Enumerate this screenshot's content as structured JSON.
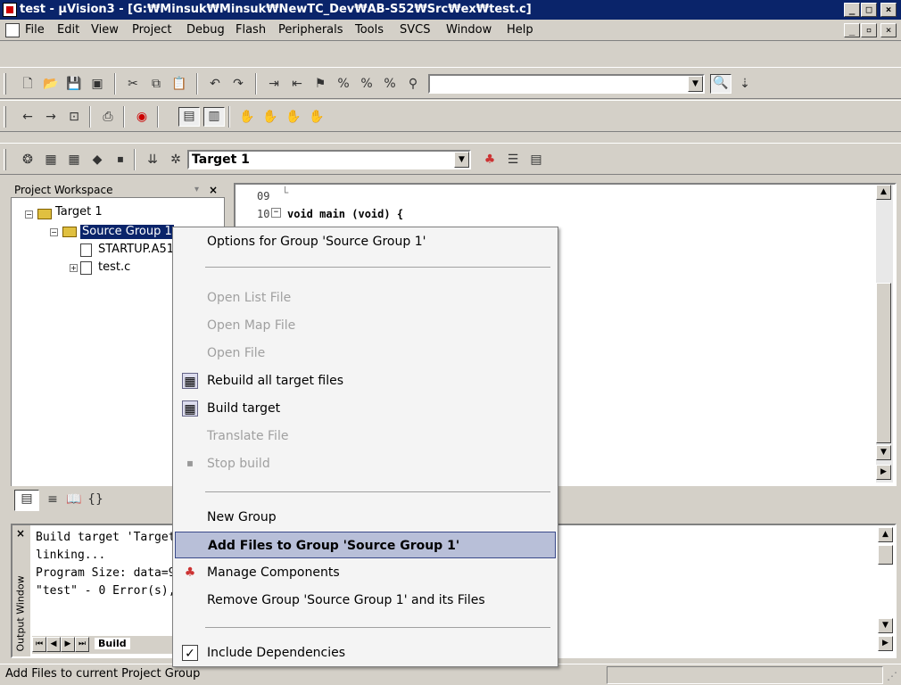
{
  "title_bar": {
    "title": "test  - µVision3 - [G:₩Minsuk₩Minsuk₩NewTC_Dev₩AB-S52₩Src₩ex₩test.c]",
    "min": "_",
    "max": "□",
    "close": "×"
  },
  "menu": {
    "items": [
      "File",
      "Edit",
      "View",
      "Project",
      "Debug",
      "Flash",
      "Peripherals",
      "Tools",
      "SVCS",
      "Window",
      "Help"
    ],
    "mdi_min": "_",
    "mdi_restore": "▫",
    "mdi_close": "×"
  },
  "toolbar": {
    "target_combo": "Target 1",
    "search_combo": ""
  },
  "workspace": {
    "header": "Project Workspace",
    "close": "×",
    "pin": "▾",
    "tree": {
      "target": "Target 1",
      "group": "Source Group 1",
      "file1": "STARTUP.A51",
      "file2": "test.c"
    }
  },
  "editor": {
    "lines": [
      {
        "num": "09",
        "text": ""
      },
      {
        "num": "10",
        "text": "void main (void) {"
      }
    ]
  },
  "output": {
    "lines": [
      "Build target 'Target 1'",
      "linking...",
      "Program Size: data=9.0 xdata=0 code=1093",
      "\"test\" - 0 Error(s), 0 Warning(s)."
    ],
    "side_label": "Output Window",
    "close": "×",
    "tab": "Build"
  },
  "status": {
    "text": "Add Files to current Project Group"
  },
  "context_menu": {
    "items": [
      {
        "label": "Options for Group 'Source Group 1'",
        "state": "normal",
        "icon": ""
      },
      {
        "label": "Open List File",
        "state": "disabled",
        "icon": ""
      },
      {
        "label": "Open Map File",
        "state": "disabled",
        "icon": ""
      },
      {
        "label": "Open File",
        "state": "disabled",
        "icon": ""
      },
      {
        "label": "Rebuild all target files",
        "state": "normal",
        "icon": "rebuild-icon"
      },
      {
        "label": "Build target",
        "state": "normal",
        "icon": "build-icon"
      },
      {
        "label": "Translate File",
        "state": "disabled",
        "icon": ""
      },
      {
        "label": "Stop build",
        "state": "disabled",
        "icon": "stop-build-icon"
      },
      {
        "label": "New Group",
        "state": "normal",
        "icon": ""
      },
      {
        "label": "Add Files to Group 'Source Group 1'",
        "state": "highlighted",
        "icon": ""
      },
      {
        "label": "Manage Components",
        "state": "normal",
        "icon": "components-icon"
      },
      {
        "label": "Remove Group 'Source Group 1' and its Files",
        "state": "normal",
        "icon": ""
      },
      {
        "label": "Include Dependencies",
        "state": "checked",
        "icon": "check-icon"
      }
    ]
  },
  "colors": {
    "title_bg": "#0a246a",
    "highlight": "#b8bfd8"
  }
}
